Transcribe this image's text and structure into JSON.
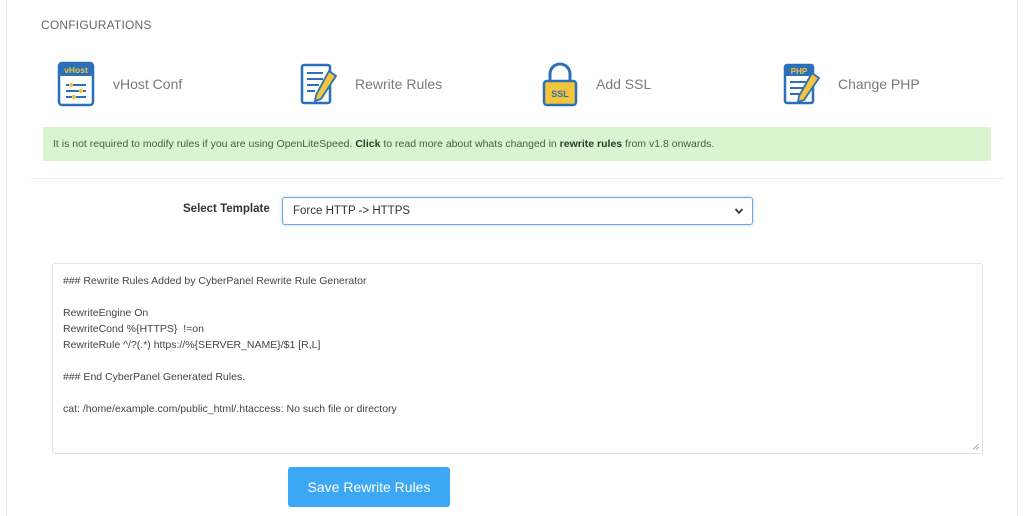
{
  "section": {
    "title": "CONFIGURATIONS"
  },
  "configs": [
    {
      "label": "vHost Conf",
      "icon": "vhost-conf-icon",
      "badge": "vHost"
    },
    {
      "label": "Rewrite Rules",
      "icon": "rewrite-rules-icon"
    },
    {
      "label": "Add SSL",
      "icon": "ssl-lock-icon",
      "badge": "SSL"
    },
    {
      "label": "Change PHP",
      "icon": "php-file-icon",
      "badge": "PHP"
    }
  ],
  "notice": {
    "text_1": "It is not required to modify rules if you are using OpenLiteSpeed.",
    "link": "Click",
    "text_2": "to read more about whats changed in",
    "bold": "rewrite rules",
    "text_3": "from v1.8 onwards."
  },
  "template": {
    "label": "Select Template",
    "selected": "Force HTTP -> HTTPS"
  },
  "editor": {
    "lines": [
      "### Rewrite Rules Added by CyberPanel Rewrite Rule Generator",
      "",
      "RewriteEngine On",
      "RewriteCond %{HTTPS}  !=on",
      "RewriteRule ^/?(.*) https://%{SERVER_NAME}/$1 [R,L]",
      "",
      "### End CyberPanel Generated Rules.",
      "",
      "cat: /home/example.com/public_html/.htaccess: No such file or directory"
    ]
  },
  "save_button": {
    "label": "Save Rewrite Rules"
  },
  "colors": {
    "accent": "#3ba7f5",
    "notice_bg": "#d9f5d0",
    "icon_blue": "#2a6fb8",
    "icon_yellow": "#f3c53a"
  }
}
